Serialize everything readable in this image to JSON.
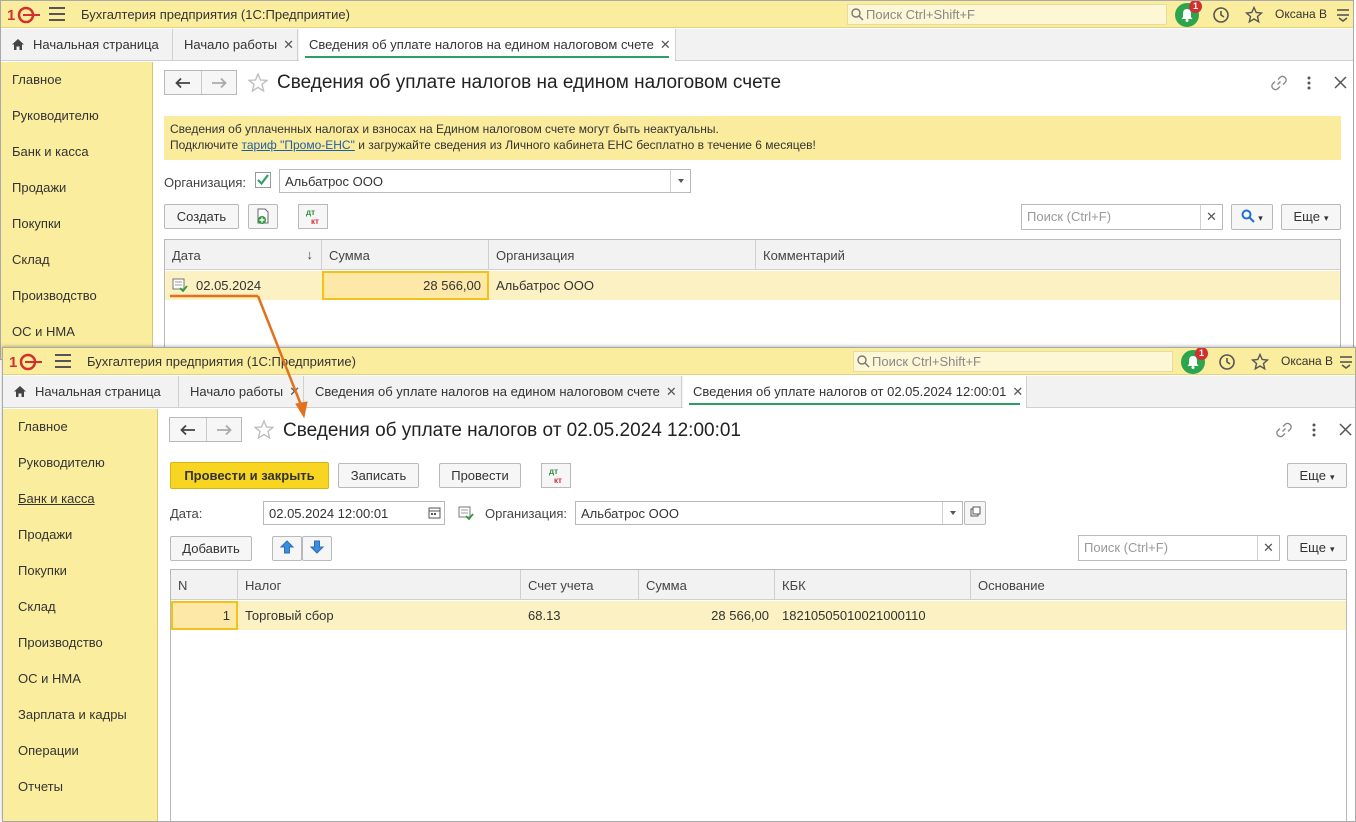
{
  "app_title": "Бухгалтерия предприятия  (1С:Предприятие)",
  "search_placeholder": "Поиск Ctrl+Shift+F",
  "notification_count": "1",
  "user": "Оксана В",
  "sidebar": [
    "Главное",
    "Руководителю",
    "Банк и касса",
    "Продажи",
    "Покупки",
    "Склад",
    "Производство",
    "ОС и НМА",
    "Зарплата и кадры",
    "Операции",
    "Отчеты"
  ],
  "window1": {
    "tabs": [
      {
        "label": "Начальная страница"
      },
      {
        "label": "Начало работы"
      },
      {
        "label": "Сведения об уплате налогов на едином налоговом счете"
      }
    ],
    "title": "Сведения об уплате налогов на едином налоговом счете",
    "notice_line1": "Сведения об уплаченных налогах и взносах на Едином налоговом счете могут быть неактуальны.",
    "notice_pre": "Подключите ",
    "notice_link": "тариф \"Промо-ЕНС\"",
    "notice_post": " и загружайте сведения из Личного кабинета ЕНС бесплатно в течение 6 месяцев!",
    "org_label": "Организация:",
    "org_value": "Альбатрос ООО",
    "create_label": "Создать",
    "search_placeholder": "Поиск (Ctrl+F)",
    "more_label": "Еще",
    "columns": [
      "Дата",
      "Сумма",
      "Организация",
      "Комментарий"
    ],
    "rows": [
      {
        "date": "02.05.2024",
        "sum": "28 566,00",
        "org": "Альбатрос ООО",
        "comment": ""
      }
    ]
  },
  "window2": {
    "tabs": [
      {
        "label": "Начальная страница"
      },
      {
        "label": "Начало работы"
      },
      {
        "label": "Сведения об уплате налогов на едином налоговом счете"
      },
      {
        "label": "Сведения об уплате налогов от 02.05.2024 12:00:01"
      }
    ],
    "title": "Сведения об уплате налогов от 02.05.2024 12:00:01",
    "post_close_label": "Провести и закрыть",
    "save_label": "Записать",
    "post_label": "Провести",
    "more_label": "Еще",
    "date_label": "Дата:",
    "date_value": "02.05.2024 12:00:01",
    "org_label": "Организация:",
    "org_value": "Альбатрос ООО",
    "add_label": "Добавить",
    "search_placeholder": "Поиск (Ctrl+F)",
    "columns": [
      "N",
      "Налог",
      "Счет учета",
      "Сумма",
      "КБК",
      "Основание"
    ],
    "rows": [
      {
        "n": "1",
        "tax": "Торговый сбор",
        "account": "68.13",
        "sum": "28 566,00",
        "kbk": "18210505010021000110",
        "basis": ""
      }
    ]
  },
  "colors": {
    "accent_green": "#2c9f63",
    "panel_yellow": "#fbed9e",
    "primary_button": "#f7d521",
    "arrow": "#e2711d"
  }
}
